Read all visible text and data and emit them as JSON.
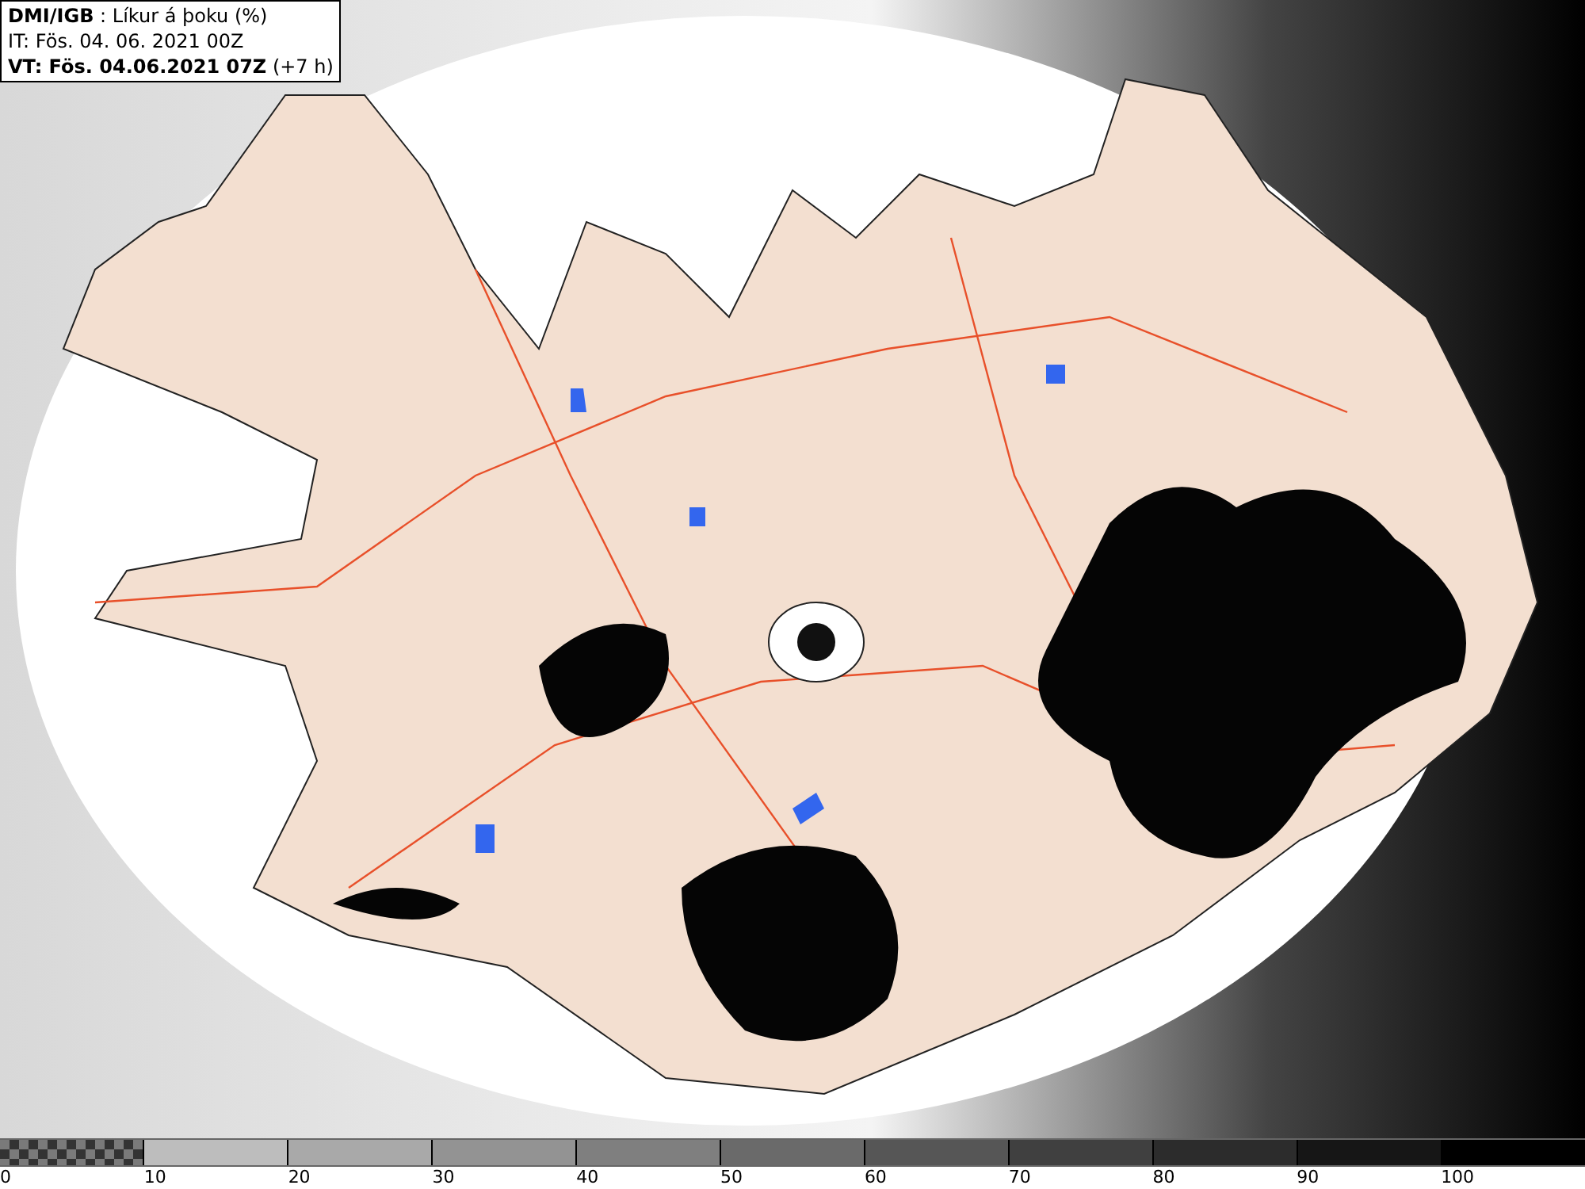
{
  "header": {
    "title_line": "**DMI/IGB** : Líkur á þoku (%)",
    "issue_time": "IT: Fös. 04. 06. 2021 00Z",
    "valid_time_line": "**VT: Fös. 04.06.2021 07Z** (+7 h)"
  },
  "legend": {
    "swatches": [
      {
        "kind": "checker",
        "color": "#7a7a7a"
      },
      {
        "kind": "solid",
        "color": "#bdbdbd"
      },
      {
        "kind": "solid",
        "color": "#a9a9a9"
      },
      {
        "kind": "solid",
        "color": "#939393"
      },
      {
        "kind": "solid",
        "color": "#7f7f7f"
      },
      {
        "kind": "solid",
        "color": "#6a6a6a"
      },
      {
        "kind": "solid",
        "color": "#565656"
      },
      {
        "kind": "solid",
        "color": "#404040"
      },
      {
        "kind": "solid",
        "color": "#2c2c2c"
      },
      {
        "kind": "solid",
        "color": "#161616"
      },
      {
        "kind": "solid",
        "color": "#000000"
      }
    ],
    "labels": [
      "0",
      "10",
      "20",
      "30",
      "40",
      "50",
      "60",
      "70",
      "80",
      "90",
      "100"
    ]
  }
}
